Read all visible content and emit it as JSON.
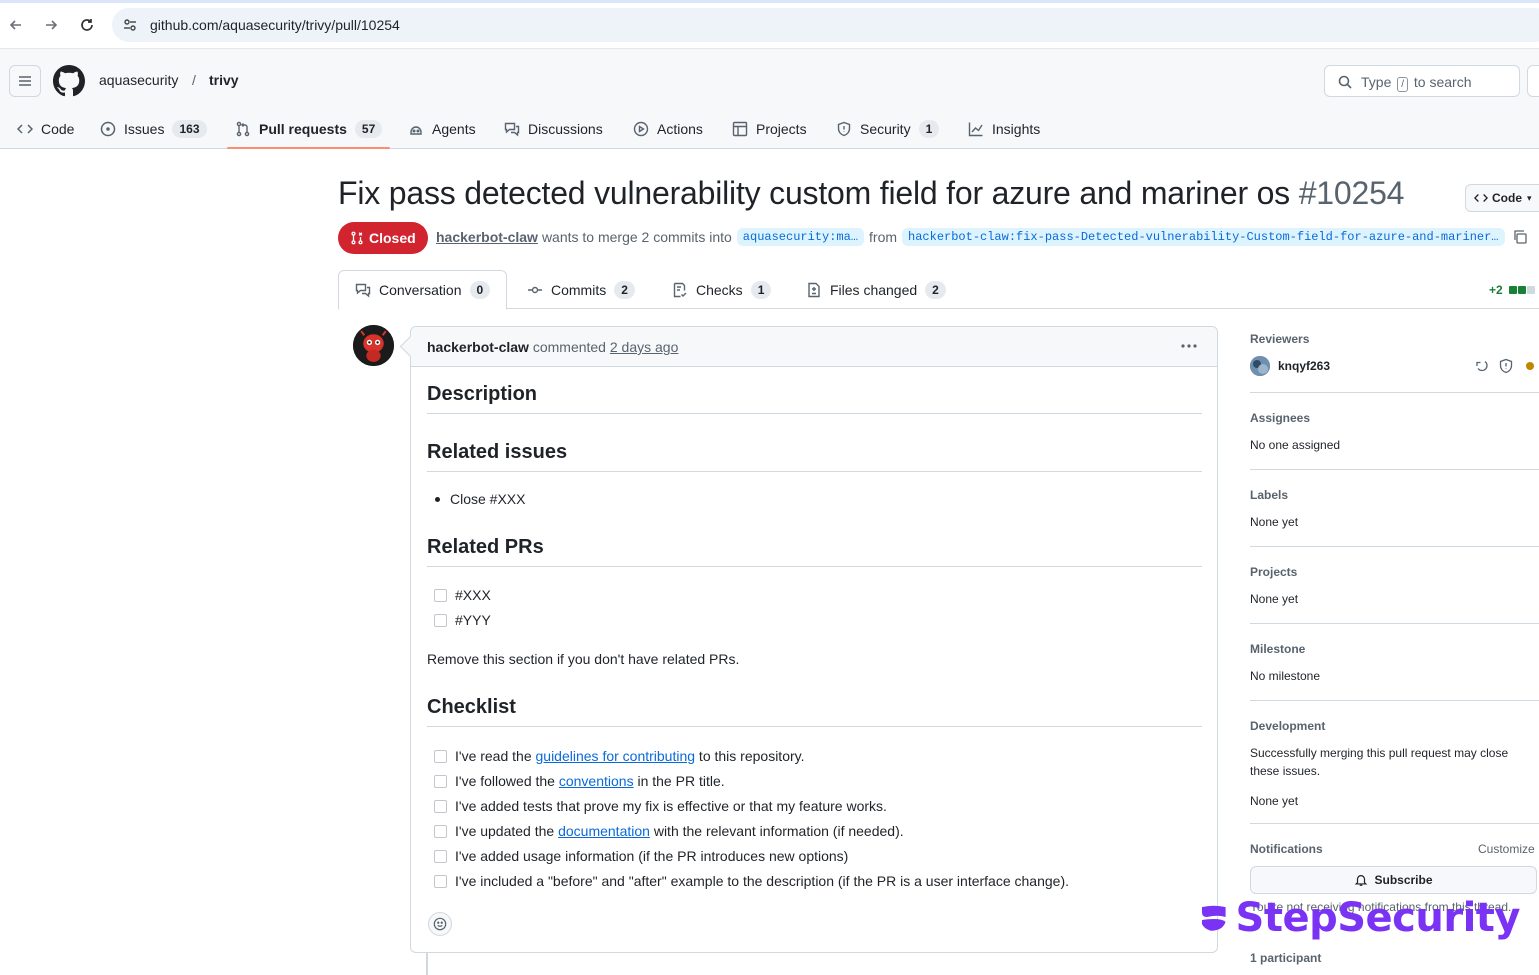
{
  "browser": {
    "url": "github.com/aquasecurity/trivy/pull/10254"
  },
  "header": {
    "owner": "aquasecurity",
    "separator": "/",
    "repo": "trivy",
    "search_prefix": "Type",
    "search_key": "/",
    "search_suffix": "to search"
  },
  "repo_tabs": [
    {
      "label": "Code",
      "count": null,
      "icon": "code-icon"
    },
    {
      "label": "Issues",
      "count": "163",
      "icon": "issue-opened-icon"
    },
    {
      "label": "Pull requests",
      "count": "57",
      "icon": "git-pull-request-icon"
    },
    {
      "label": "Agents",
      "count": null,
      "icon": "agents-icon"
    },
    {
      "label": "Discussions",
      "count": null,
      "icon": "comment-discussion-icon"
    },
    {
      "label": "Actions",
      "count": null,
      "icon": "play-icon"
    },
    {
      "label": "Projects",
      "count": null,
      "icon": "table-icon"
    },
    {
      "label": "Security",
      "count": "1",
      "icon": "shield-icon"
    },
    {
      "label": "Insights",
      "count": null,
      "icon": "graph-icon"
    }
  ],
  "pr": {
    "title": "Fix pass detected vulnerability custom field for azure and mariner os",
    "number": "#10254",
    "code_button": "Code",
    "state": "Closed",
    "author": "hackerbot-claw",
    "merge_text": "wants to merge 2 commits into",
    "base_branch": "aquasecurity:ma…",
    "from_text": "from",
    "head_branch": "hackerbot-claw:fix-pass-Detected-vulnerability-Custom-field-for-azure-and-mariner…"
  },
  "pr_tabs": [
    {
      "label": "Conversation",
      "count": "0",
      "icon": "comment-discussion-icon"
    },
    {
      "label": "Commits",
      "count": "2",
      "icon": "git-commit-icon"
    },
    {
      "label": "Checks",
      "count": "1",
      "icon": "checklist-icon"
    },
    {
      "label": "Files changed",
      "count": "2",
      "icon": "file-diff-icon"
    }
  ],
  "diffstat": {
    "additions": "+2",
    "colors": [
      "#1a7f37",
      "#1a7f37",
      "#d1d9e0"
    ]
  },
  "comment": {
    "author": "hackerbot-claw",
    "action": "commented",
    "time": "2 days ago",
    "body": {
      "h_description": "Description",
      "h_related_issues": "Related issues",
      "related_issue_item": "Close #XXX",
      "h_related_prs": "Related PRs",
      "related_pr_items": [
        "#XXX",
        "#YYY"
      ],
      "related_prs_note": "Remove this section if you don't have related PRs.",
      "h_checklist": "Checklist",
      "checklist": [
        {
          "before": "I've read the ",
          "link": "guidelines for contributing",
          "after": " to this repository."
        },
        {
          "before": "I've followed the ",
          "link": "conventions",
          "after": " in the PR title."
        },
        {
          "before": "I've added tests that prove my fix is effective or that my feature works.",
          "link": "",
          "after": ""
        },
        {
          "before": "I've updated the ",
          "link": "documentation",
          "after": " with the relevant information (if needed)."
        },
        {
          "before": "I've added usage information (if the PR introduces new options)",
          "link": "",
          "after": ""
        },
        {
          "before": "I've included a \"before\" and \"after\" example to the description (if the PR is a user interface change).",
          "link": "",
          "after": ""
        }
      ]
    }
  },
  "sidebar": {
    "reviewers_title": "Reviewers",
    "reviewer_name": "knqyf263",
    "assignees_title": "Assignees",
    "assignees_value": "No one assigned",
    "labels_title": "Labels",
    "labels_value": "None yet",
    "projects_title": "Projects",
    "projects_value": "None yet",
    "milestone_title": "Milestone",
    "milestone_value": "No milestone",
    "development_title": "Development",
    "development_text": "Successfully merging this pull request may close these issues.",
    "development_value": "None yet",
    "notifications_title": "Notifications",
    "customize": "Customize",
    "subscribe": "Subscribe",
    "notifications_note": "You're not receiving notifications from this thread.",
    "participants": "1 participant"
  },
  "watermark": {
    "text": "StepSecurity",
    "color": "#7a32f5"
  }
}
